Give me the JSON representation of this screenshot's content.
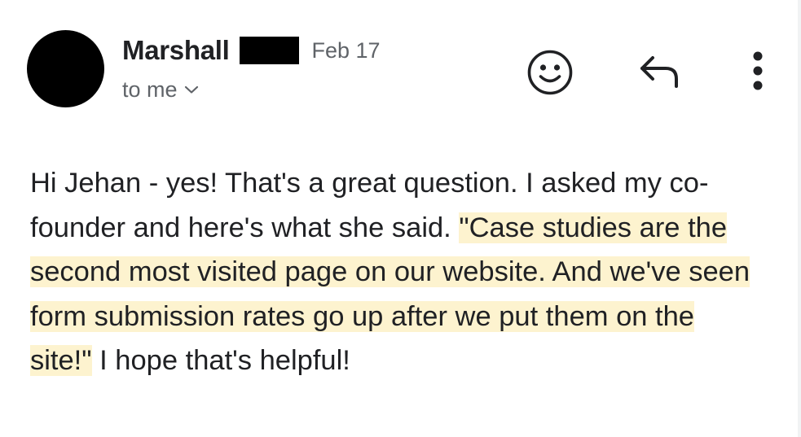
{
  "message": {
    "sender_name": "Marshall",
    "date": "Feb 17",
    "recipient": "to me",
    "body": {
      "intro": "Hi Jehan - yes! That's a great question. I asked my co-founder and here's what she said. ",
      "quote": "\"Case studies are the second most visited page on our website. And we've seen form submission rates go up after we put them on the site!\"",
      "outro": " I hope that's helpful!"
    }
  },
  "icons": {
    "recipient_toggle": "chevron-down-icon",
    "emoji": "smiley-icon",
    "reply": "reply-arrow-icon",
    "more": "more-vertical-icon"
  },
  "colors": {
    "highlight": "#fdf3cf",
    "secondary_text": "#5f6368",
    "primary_text": "#202124"
  }
}
